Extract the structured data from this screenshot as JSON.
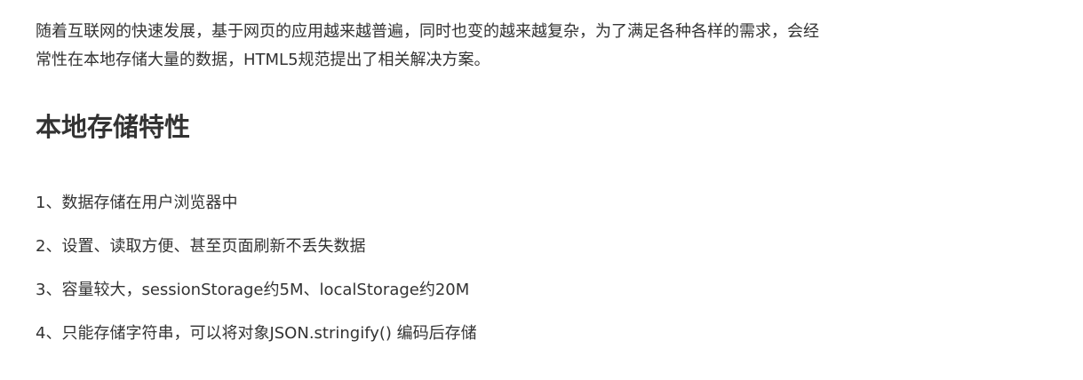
{
  "intro": {
    "line1": "随着互联网的快速发展，基于网页的应用越来越普遍，同时也变的越来越复杂，为了满足各种各样的需求，会经",
    "line2": "常性在本地存储大量的数据，HTML5规范提出了相关解决方案。"
  },
  "section": {
    "title": "本地存储特性"
  },
  "features": [
    "1、数据存储在用户浏览器中",
    "2、设置、读取方便、甚至页面刷新不丢失数据",
    "3、容量较大，sessionStorage约5M、localStorage约20M",
    "4、只能存储字符串，可以将对象JSON.stringify() 编码后存储"
  ]
}
